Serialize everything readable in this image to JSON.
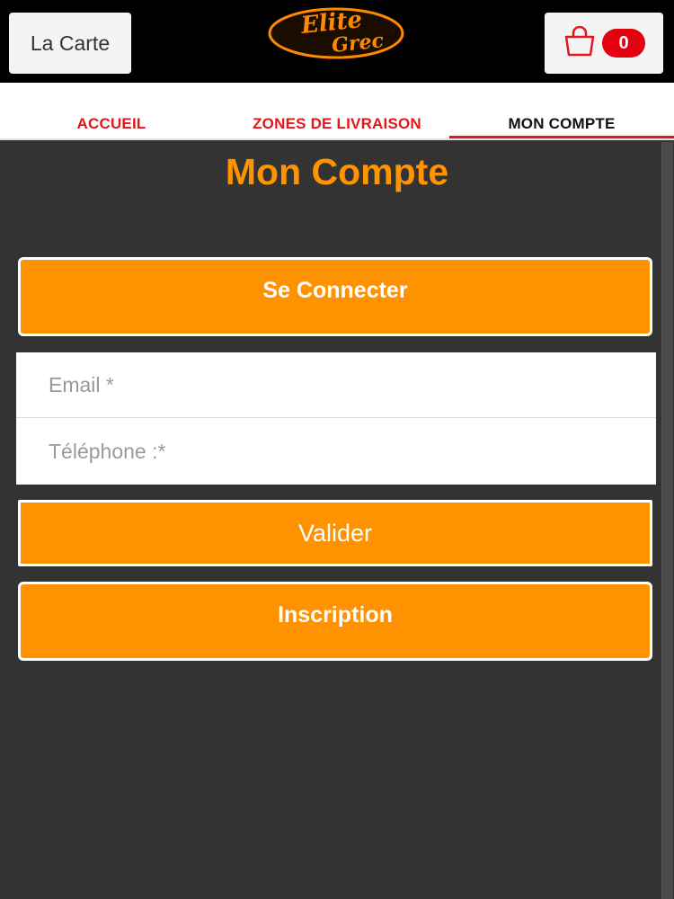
{
  "header": {
    "menu_label": "La Carte",
    "logo_text": "Elite Grec",
    "cart_count": "0"
  },
  "nav": {
    "tabs": [
      {
        "label": "ACCUEIL"
      },
      {
        "label": "ZONES DE LIVRAISON"
      },
      {
        "label": "MON COMPTE"
      }
    ]
  },
  "main": {
    "title": "Mon Compte",
    "login_button": "Se Connecter",
    "email_placeholder": "Email *",
    "phone_placeholder": "Téléphone :*",
    "submit_button": "Valider",
    "signup_button": "Inscription"
  },
  "colors": {
    "accent": "#ff9200",
    "nav_link": "#e3161b",
    "badge": "#e3000f",
    "background": "#333333"
  }
}
